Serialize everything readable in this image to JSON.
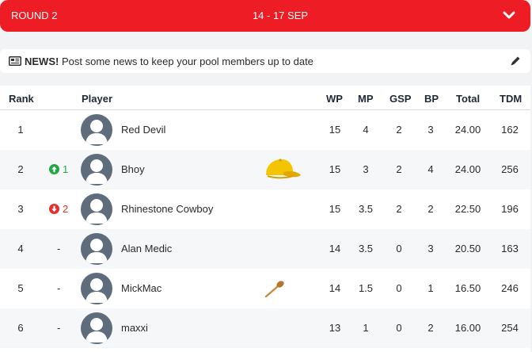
{
  "round": {
    "label": "ROUND 2",
    "dates": "14 - 17 SEP"
  },
  "news": {
    "title": "NEWS!",
    "text": "Post some news to keep your pool members up to date"
  },
  "table": {
    "headers": {
      "rank": "Rank",
      "player": "Player",
      "wp": "WP",
      "mp": "MP",
      "gsp": "GSP",
      "bp": "BP",
      "total": "Total",
      "tdm": "TDM"
    },
    "rows": [
      {
        "rank": "1",
        "move": "",
        "direction": "none",
        "player": "Red Devil",
        "wp": "15",
        "mp": "4",
        "gsp": "2",
        "bp": "3",
        "total": "24.00",
        "tdm": "162",
        "badge": ""
      },
      {
        "rank": "2",
        "move": "1",
        "direction": "up",
        "player": "Bhoy",
        "wp": "15",
        "mp": "3",
        "gsp": "2",
        "bp": "4",
        "total": "24.00",
        "tdm": "256",
        "badge": "yellow-cap-icon"
      },
      {
        "rank": "3",
        "move": "2",
        "direction": "down",
        "player": "Rhinestone Cowboy",
        "wp": "15",
        "mp": "3.5",
        "gsp": "2",
        "bp": "2",
        "total": "22.50",
        "tdm": "196",
        "badge": ""
      },
      {
        "rank": "4",
        "move": "-",
        "direction": "same",
        "player": "Alan Medic",
        "wp": "14",
        "mp": "3.5",
        "gsp": "0",
        "bp": "3",
        "total": "20.50",
        "tdm": "163",
        "badge": ""
      },
      {
        "rank": "5",
        "move": "-",
        "direction": "same",
        "player": "MickMac",
        "wp": "14",
        "mp": "1.5",
        "gsp": "0",
        "bp": "1",
        "total": "16.50",
        "tdm": "246",
        "badge": "wooden-spoon-icon"
      },
      {
        "rank": "6",
        "move": "-",
        "direction": "same",
        "player": "maxxi",
        "wp": "13",
        "mp": "1",
        "gsp": "0",
        "bp": "2",
        "total": "16.00",
        "tdm": "254",
        "badge": ""
      }
    ]
  },
  "colors": {
    "accent": "#ee1c25",
    "up": "#22a745",
    "down": "#e03131",
    "avatar": "#5e6c7b"
  }
}
